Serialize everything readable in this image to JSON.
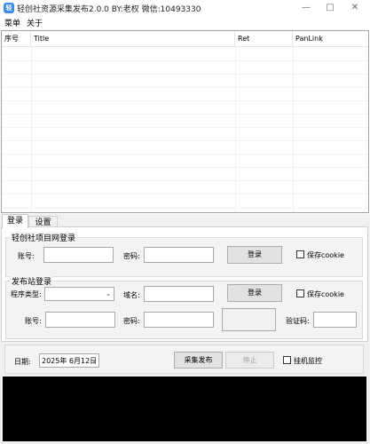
{
  "window": {
    "title": "轻创社资源采集发布2.0.0   BY:老权   微信:10493330",
    "icon_text": "轻"
  },
  "menu": {
    "items": [
      "菜单",
      "关于"
    ]
  },
  "grid": {
    "columns": [
      "序号",
      "Title",
      "Ret",
      "PanLink"
    ],
    "rows": []
  },
  "tabs": {
    "items": [
      "登录",
      "设置"
    ],
    "active": "登录"
  },
  "login_group": {
    "title": "轻创社项目网登录",
    "account_label": "账号:",
    "account_value": "",
    "password_label": "密码:",
    "password_value": "",
    "login_button": "登录",
    "save_cookie_label": "保存cookie",
    "save_cookie_checked": false
  },
  "publish_group": {
    "title": "发布站登录",
    "program_type_label": "程序类型:",
    "program_type_value": "",
    "domain_label": "域名:",
    "domain_value": "",
    "login_button": "登录",
    "save_cookie_label": "保存cookie",
    "save_cookie_checked": false,
    "account_label": "账号:",
    "account_value": "",
    "password_label": "密码:",
    "password_value": "",
    "captcha_label": "验证码:",
    "captcha_value": ""
  },
  "controls": {
    "date_label": "日期:",
    "date_value": "2025年 6月12日",
    "collect_button": "采集发布",
    "stop_button": "停止",
    "monitor_label": "挂机监控",
    "monitor_checked": false
  },
  "colors": {
    "icon_blue": "#3a8ee6",
    "log_background": "#000000",
    "panel_background": "#f0f0f0"
  }
}
